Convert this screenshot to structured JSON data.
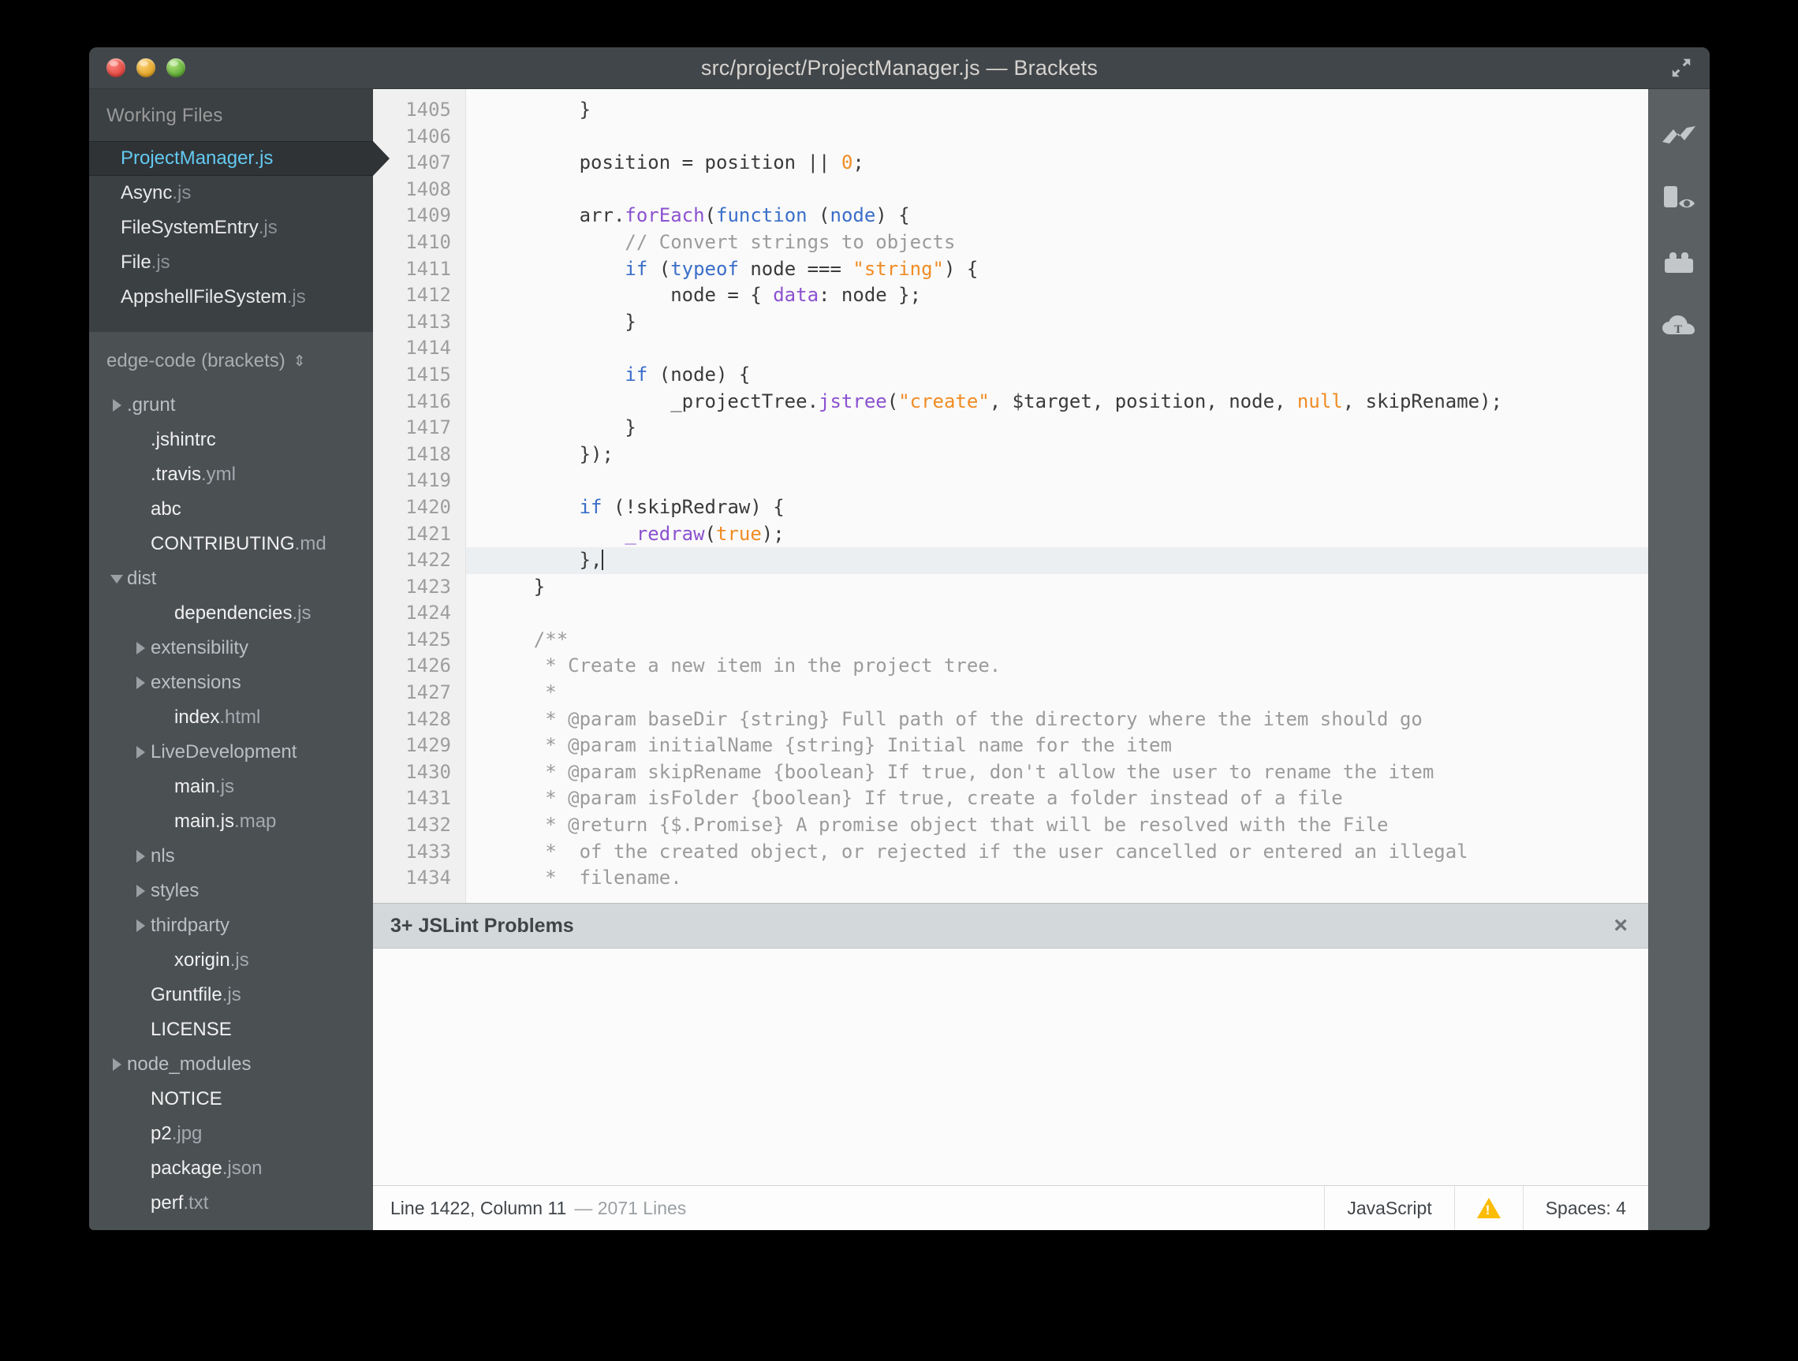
{
  "window": {
    "title": "src/project/ProjectManager.js — Brackets",
    "traffic_lights": [
      "close",
      "minimize",
      "maximize"
    ],
    "expand_icon": "expand-arrows-icon"
  },
  "sidebar": {
    "working_files_header": "Working Files",
    "working_files": [
      {
        "name": "ProjectManager",
        "ext": ".js",
        "selected": true
      },
      {
        "name": "Async",
        "ext": ".js",
        "selected": false
      },
      {
        "name": "FileSystemEntry",
        "ext": ".js",
        "selected": false
      },
      {
        "name": "File",
        "ext": ".js",
        "selected": false
      },
      {
        "name": "AppshellFileSystem",
        "ext": ".js",
        "selected": false
      }
    ],
    "project_title": "edge-code (brackets)",
    "project_title_chevrons": "⇕",
    "tree": [
      {
        "name": ".grunt",
        "ext": "",
        "type": "folder",
        "state": "collapsed",
        "indent": 0
      },
      {
        "name": ".jshintrc",
        "ext": "",
        "type": "folder-like-file",
        "state": "none",
        "indent": 1
      },
      {
        "name": ".travis",
        "ext": ".yml",
        "type": "file",
        "state": "none",
        "indent": 1
      },
      {
        "name": "abc",
        "ext": "",
        "type": "file",
        "state": "none",
        "indent": 1
      },
      {
        "name": "CONTRIBUTING",
        "ext": ".md",
        "type": "file",
        "state": "none",
        "indent": 1
      },
      {
        "name": "dist",
        "ext": "",
        "type": "folder",
        "state": "expanded",
        "indent": 0
      },
      {
        "name": "dependencies",
        "ext": ".js",
        "type": "file",
        "state": "none",
        "indent": 2
      },
      {
        "name": "extensibility",
        "ext": "",
        "type": "folder",
        "state": "collapsed",
        "indent": 1
      },
      {
        "name": "extensions",
        "ext": "",
        "type": "folder",
        "state": "collapsed",
        "indent": 1
      },
      {
        "name": "index",
        "ext": ".html",
        "type": "file",
        "state": "none",
        "indent": 2
      },
      {
        "name": "LiveDevelopment",
        "ext": "",
        "type": "folder",
        "state": "collapsed",
        "indent": 1
      },
      {
        "name": "main",
        "ext": ".js",
        "type": "file",
        "state": "none",
        "indent": 2
      },
      {
        "name": "main.js",
        "ext": ".map",
        "type": "file",
        "state": "none",
        "indent": 2
      },
      {
        "name": "nls",
        "ext": "",
        "type": "folder",
        "state": "collapsed",
        "indent": 1
      },
      {
        "name": "styles",
        "ext": "",
        "type": "folder",
        "state": "collapsed",
        "indent": 1
      },
      {
        "name": "thirdparty",
        "ext": "",
        "type": "folder",
        "state": "collapsed",
        "indent": 1
      },
      {
        "name": "xorigin",
        "ext": ".js",
        "type": "file",
        "state": "none",
        "indent": 2
      },
      {
        "name": "Gruntfile",
        "ext": ".js",
        "type": "file",
        "state": "none",
        "indent": 1
      },
      {
        "name": "LICENSE",
        "ext": "",
        "type": "file",
        "state": "none",
        "indent": 1
      },
      {
        "name": "node_modules",
        "ext": "",
        "type": "folder",
        "state": "collapsed",
        "indent": 0
      },
      {
        "name": "NOTICE",
        "ext": "",
        "type": "file",
        "state": "none",
        "indent": 1
      },
      {
        "name": "p2",
        "ext": ".jpg",
        "type": "file",
        "state": "none",
        "indent": 1
      },
      {
        "name": "package",
        "ext": ".json",
        "type": "file",
        "state": "none",
        "indent": 1
      },
      {
        "name": "perf",
        "ext": ".txt",
        "type": "file",
        "state": "none",
        "indent": 1
      }
    ]
  },
  "editor": {
    "first_line_number": 1405,
    "active_line": 1422,
    "lines": [
      {
        "n": 1405,
        "tokens": [
          {
            "t": "        }"
          }
        ]
      },
      {
        "n": 1406,
        "tokens": [
          {
            "t": ""
          }
        ]
      },
      {
        "n": 1407,
        "tokens": [
          {
            "t": "        position = position || "
          },
          {
            "t": "0",
            "c": "num"
          },
          {
            "t": ";"
          }
        ]
      },
      {
        "n": 1408,
        "tokens": [
          {
            "t": ""
          }
        ]
      },
      {
        "n": 1409,
        "tokens": [
          {
            "t": "        arr."
          },
          {
            "t": "forEach",
            "c": "fn"
          },
          {
            "t": "("
          },
          {
            "t": "function",
            "c": "k"
          },
          {
            "t": " ("
          },
          {
            "t": "node",
            "c": "k"
          },
          {
            "t": ") {"
          }
        ]
      },
      {
        "n": 1410,
        "tokens": [
          {
            "t": "            // Convert strings to objects",
            "c": "cm"
          }
        ]
      },
      {
        "n": 1411,
        "tokens": [
          {
            "t": "            "
          },
          {
            "t": "if",
            "c": "k"
          },
          {
            "t": " ("
          },
          {
            "t": "typeof",
            "c": "k"
          },
          {
            "t": " node === "
          },
          {
            "t": "\"string\"",
            "c": "str"
          },
          {
            "t": ") {"
          }
        ]
      },
      {
        "n": 1412,
        "tokens": [
          {
            "t": "                node = { "
          },
          {
            "t": "data",
            "c": "prop"
          },
          {
            "t": ": node };"
          }
        ]
      },
      {
        "n": 1413,
        "tokens": [
          {
            "t": "            }"
          }
        ]
      },
      {
        "n": 1414,
        "tokens": [
          {
            "t": ""
          }
        ]
      },
      {
        "n": 1415,
        "tokens": [
          {
            "t": "            "
          },
          {
            "t": "if",
            "c": "k"
          },
          {
            "t": " (node) {"
          }
        ]
      },
      {
        "n": 1416,
        "tokens": [
          {
            "t": "                _projectTree."
          },
          {
            "t": "jstree",
            "c": "fn"
          },
          {
            "t": "("
          },
          {
            "t": "\"create\"",
            "c": "str"
          },
          {
            "t": ", $target, position, node, "
          },
          {
            "t": "null",
            "c": "atom"
          },
          {
            "t": ", skipRename);"
          }
        ]
      },
      {
        "n": 1417,
        "tokens": [
          {
            "t": "            }"
          }
        ]
      },
      {
        "n": 1418,
        "tokens": [
          {
            "t": "        });"
          }
        ]
      },
      {
        "n": 1419,
        "tokens": [
          {
            "t": ""
          }
        ]
      },
      {
        "n": 1420,
        "tokens": [
          {
            "t": "        "
          },
          {
            "t": "if",
            "c": "k"
          },
          {
            "t": " (!skipRedraw) {"
          }
        ]
      },
      {
        "n": 1421,
        "tokens": [
          {
            "t": "            "
          },
          {
            "t": "_redraw",
            "c": "fn"
          },
          {
            "t": "("
          },
          {
            "t": "true",
            "c": "atom"
          },
          {
            "t": ");"
          }
        ]
      },
      {
        "n": 1422,
        "tokens": [
          {
            "t": "        },"
          }
        ],
        "active": true,
        "caret": true
      },
      {
        "n": 1423,
        "tokens": [
          {
            "t": "    }"
          }
        ]
      },
      {
        "n": 1424,
        "tokens": [
          {
            "t": ""
          }
        ]
      },
      {
        "n": 1425,
        "tokens": [
          {
            "t": "    /**",
            "c": "cm"
          }
        ]
      },
      {
        "n": 1426,
        "tokens": [
          {
            "t": "     * Create a new item in the project tree.",
            "c": "cm"
          }
        ]
      },
      {
        "n": 1427,
        "tokens": [
          {
            "t": "     *",
            "c": "cm"
          }
        ]
      },
      {
        "n": 1428,
        "tokens": [
          {
            "t": "     * @param baseDir {string} Full path of the directory where the item should go",
            "c": "cm"
          }
        ]
      },
      {
        "n": 1429,
        "tokens": [
          {
            "t": "     * @param initialName {string} Initial name for the item",
            "c": "cm"
          }
        ]
      },
      {
        "n": 1430,
        "tokens": [
          {
            "t": "     * @param skipRename {boolean} If true, don't allow the user to rename the item",
            "c": "cm"
          }
        ]
      },
      {
        "n": 1431,
        "tokens": [
          {
            "t": "     * @param isFolder {boolean} If true, create a folder instead of a file",
            "c": "cm"
          }
        ]
      },
      {
        "n": 1432,
        "tokens": [
          {
            "t": "     * @return {$.Promise} A promise object that will be resolved with the File",
            "c": "cm"
          }
        ]
      },
      {
        "n": 1433,
        "tokens": [
          {
            "t": "     *  of the created object, or rejected if the user cancelled or entered an illegal",
            "c": "cm"
          }
        ]
      },
      {
        "n": 1434,
        "tokens": [
          {
            "t": "     *  filename.",
            "c": "cm"
          }
        ]
      }
    ]
  },
  "panel": {
    "title": "3+ JSLint Problems",
    "close_label": "×"
  },
  "statusbar": {
    "cursor": "Line 1422, Column 11",
    "lines_total": "— 2071 Lines",
    "language": "JavaScript",
    "warning_icon": "warning-triangle-icon",
    "indent": "Spaces:  4"
  },
  "right_toolbar": [
    {
      "icon": "live-preview-bolt-icon"
    },
    {
      "icon": "device-preview-icon"
    },
    {
      "icon": "extension-manager-icon"
    },
    {
      "icon": "cloud-typekit-icon"
    }
  ],
  "colors": {
    "window_chrome": "#41464a",
    "sidebar": "#3b4043",
    "project_panel": "#4b5053",
    "selected_file": "#63c9f0",
    "editor_bg": "#fafafa",
    "keyword": "#3a6ec9",
    "function": "#8b52d0",
    "string": "#f08c25",
    "comment": "#9b9b9b",
    "warning": "#fbbc05"
  }
}
